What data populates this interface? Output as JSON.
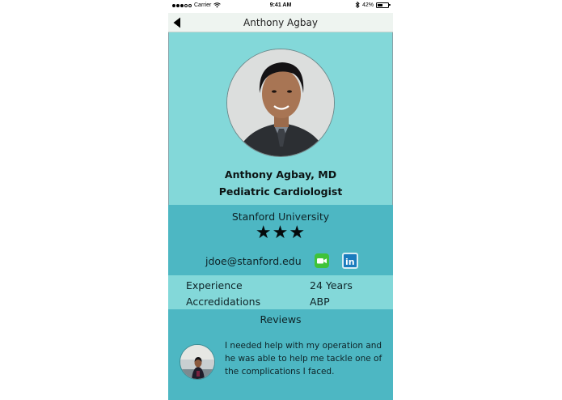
{
  "status_bar": {
    "carrier": "Carrier",
    "time": "9:41 AM",
    "battery": "42%",
    "signal_icon": "signal-dots-icon",
    "wifi_icon": "wifi-icon",
    "bluetooth_icon": "bluetooth-icon",
    "battery_icon": "battery-icon"
  },
  "nav": {
    "title": "Anthony Agbay",
    "back_icon": "back-arrow-icon"
  },
  "profile": {
    "name": "Anthony Agbay, MD",
    "title": "Pediatric Cardiologist",
    "photo_icon": "doctor-photo"
  },
  "info": {
    "university": "Stanford University",
    "rating_stars": "★★★",
    "rating": 3,
    "email": "jdoe@stanford.edu",
    "facetime_icon": "facetime-icon",
    "linkedin_icon": "linkedin-icon",
    "linkedin_text": "in"
  },
  "details": [
    {
      "label": "Experience",
      "value": "24 Years"
    },
    {
      "label": "Accredidations",
      "value": "ABP"
    }
  ],
  "reviews": {
    "title": "Reviews",
    "items": [
      {
        "text": "I needed help with my operation and he was able to help me tackle one of the complications I faced.",
        "avatar_icon": "reviewer-photo"
      }
    ]
  },
  "colors": {
    "light_teal": "#83d8d9",
    "dark_teal": "#4db7c3",
    "nav_bg": "#eef4f0",
    "facetime_green": "#3fc33a",
    "linkedin_blue": "#1a7bbd"
  }
}
